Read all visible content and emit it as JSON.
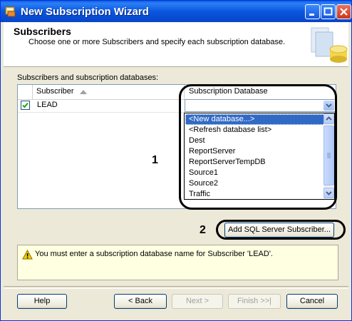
{
  "window": {
    "title": "New Subscription Wizard"
  },
  "header": {
    "title": "Subscribers",
    "description": "Choose one or more Subscribers and specify each subscription database."
  },
  "grid": {
    "label": "Subscribers and subscription databases:",
    "columns": [
      "Subscriber",
      "Subscription Database"
    ],
    "rows": [
      {
        "checked": true,
        "subscriber": "LEAD",
        "database": ""
      }
    ]
  },
  "dropdown": {
    "items": [
      "<New database...>",
      "<Refresh database list>",
      "Dest",
      "ReportServer",
      "ReportServerTempDB",
      "Source1",
      "Source2",
      "Traffic"
    ],
    "selected_index": 0
  },
  "callouts": [
    "1",
    "2"
  ],
  "buttons": {
    "add_subscriber": "Add SQL Server Subscriber...",
    "help": "Help",
    "back": "< Back",
    "next": "Next >",
    "finish": "Finish >>|",
    "cancel": "Cancel"
  },
  "message": {
    "text": "You must enter a subscription database name for Subscriber 'LEAD'."
  },
  "colors": {
    "title_bar": "#0a56de",
    "selection": "#316ac5",
    "message_bg": "#ffffe1"
  }
}
